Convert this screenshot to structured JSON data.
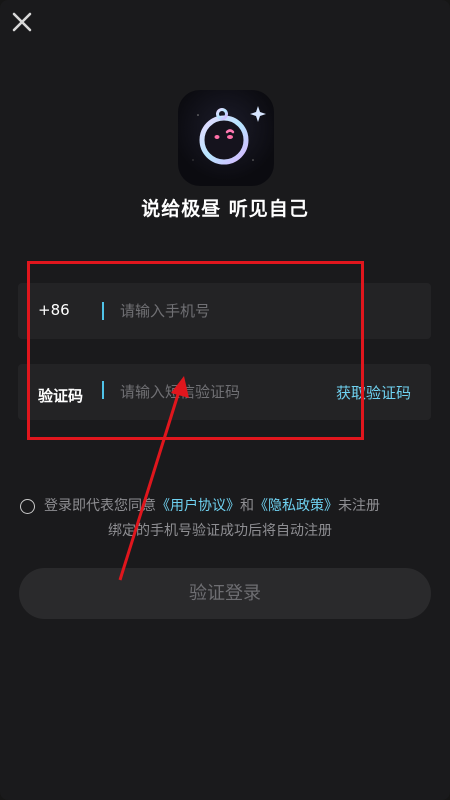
{
  "header": {
    "close_icon": "close-icon"
  },
  "brand": {
    "logo_icon": "app-logo-icon",
    "slogan": "说给极昼 听见自己"
  },
  "form": {
    "phone": {
      "prefix": "+86",
      "placeholder": "请输入手机号",
      "value": ""
    },
    "code": {
      "label": "验证码",
      "placeholder": "请输入短信验证码",
      "value": "",
      "get_code_label": "获取验证码"
    }
  },
  "agreement": {
    "checked": false,
    "text_before": "登录即代表您同意",
    "user_agreement": "《用户协议》",
    "and": "和",
    "privacy_policy": "《隐私政策》",
    "text_after": "未注册",
    "line2": "绑定的手机号验证成功后将自动注册"
  },
  "login_button": "验证登录",
  "colors": {
    "background": "#1a1a1c",
    "accent": "#6fd1f0",
    "annotation": "#e0161d"
  }
}
